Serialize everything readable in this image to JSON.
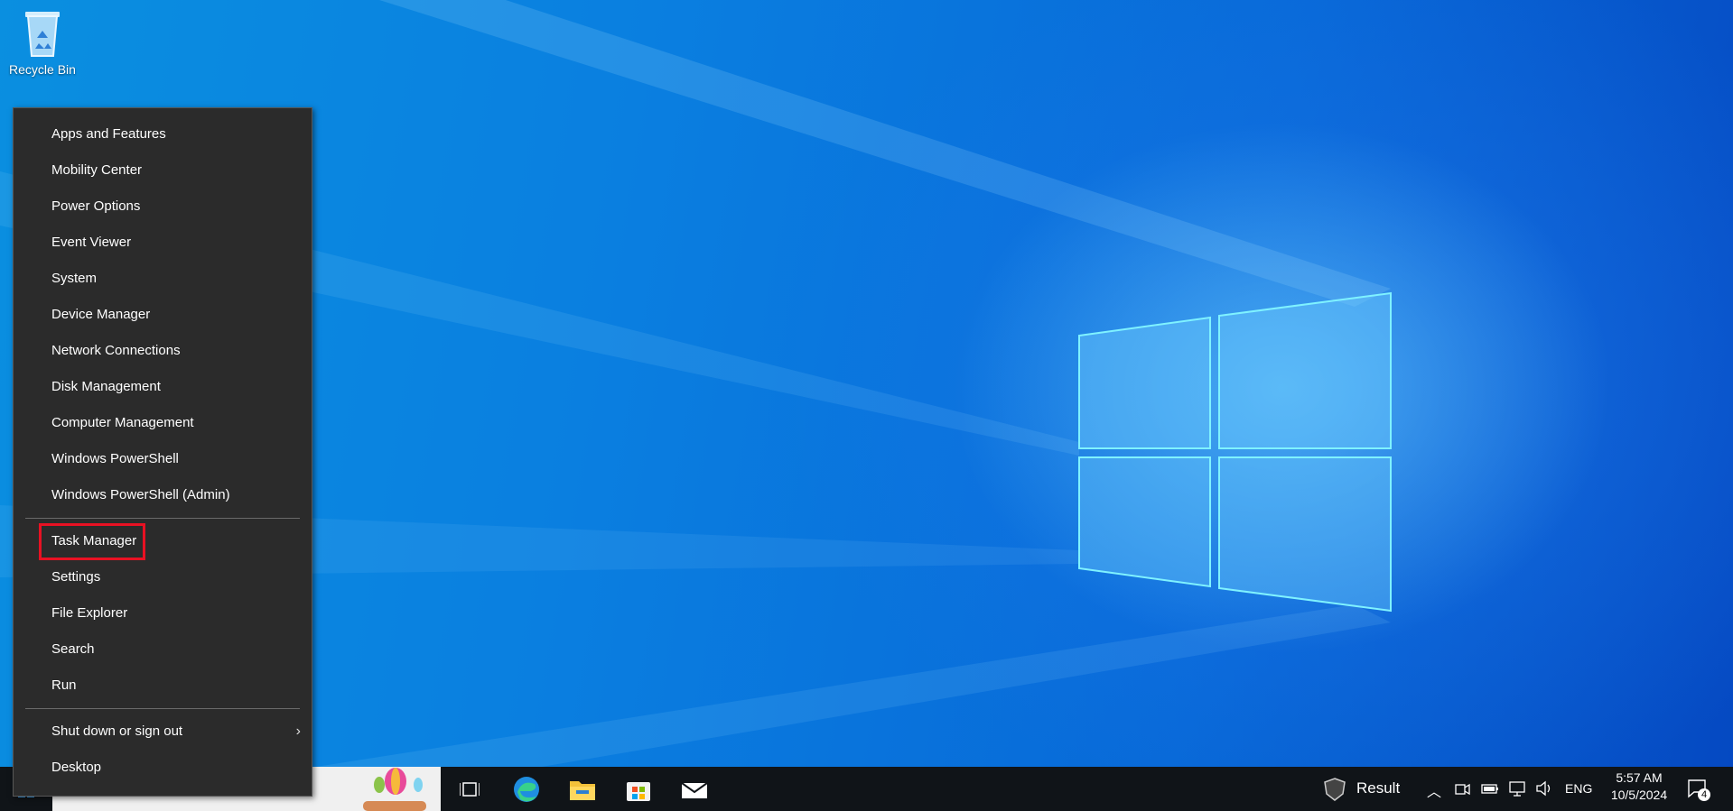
{
  "desktop": {
    "recycle_bin_label": "Recycle Bin"
  },
  "menu": {
    "group1": [
      "Apps and Features",
      "Mobility Center",
      "Power Options",
      "Event Viewer",
      "System",
      "Device Manager",
      "Network Connections",
      "Disk Management",
      "Computer Management",
      "Windows PowerShell",
      "Windows PowerShell (Admin)"
    ],
    "group2": [
      "Task Manager",
      "Settings",
      "File Explorer",
      "Search",
      "Run"
    ],
    "group3": [
      "Shut down or sign out",
      "Desktop"
    ],
    "highlighted": "Task Manager"
  },
  "taskbar": {
    "widget_label": "Result",
    "language": "ENG",
    "time": "5:57 AM",
    "date": "10/5/2024",
    "notification_count": "4"
  },
  "colors": {
    "menu_bg": "#2b2b2b",
    "highlight": "#e81123",
    "taskbar_bg": "#101418"
  }
}
